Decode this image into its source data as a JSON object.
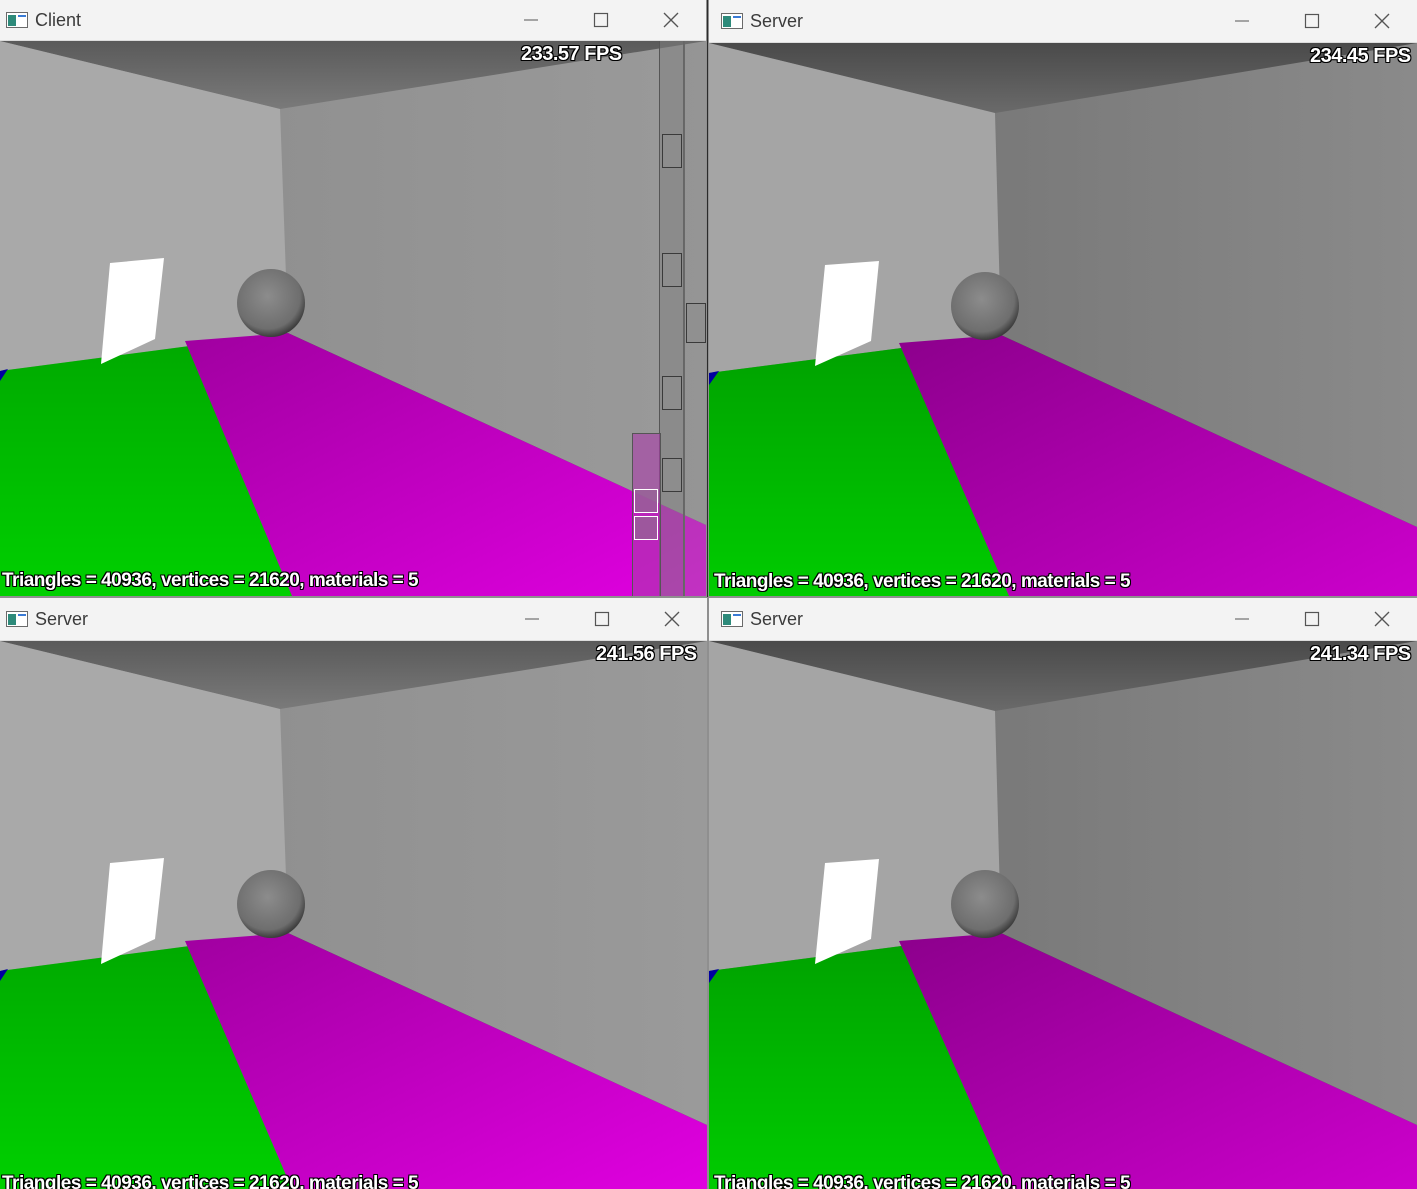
{
  "windows": [
    {
      "id": "client",
      "title": "Client",
      "fps": "233.57 FPS",
      "stats": "Triangles = 40936, vertices = 21620, materials = 5"
    },
    {
      "id": "server-1",
      "title": "Server",
      "fps": "234.45 FPS",
      "stats": "Triangles = 40936, vertices = 21620, materials = 5"
    },
    {
      "id": "server-2",
      "title": "Server",
      "fps": "241.56 FPS",
      "stats": "Triangles = 40936, vertices = 21620, materials = 5"
    },
    {
      "id": "server-3",
      "title": "Server",
      "fps": "241.34 FPS",
      "stats": "Triangles = 40936, vertices = 21620, materials = 5"
    }
  ],
  "controls": {
    "minimize_icon": "minimize-icon",
    "maximize_icon": "maximize-icon",
    "close_icon": "close-icon"
  },
  "colors": {
    "floor_green": "#00b400",
    "floor_magenta": "#c800c8",
    "wall_light": "#a8a8a8",
    "wall_back": "#8c8c8c",
    "sphere": "#7a7a7a",
    "panel_white": "#ffffff"
  }
}
